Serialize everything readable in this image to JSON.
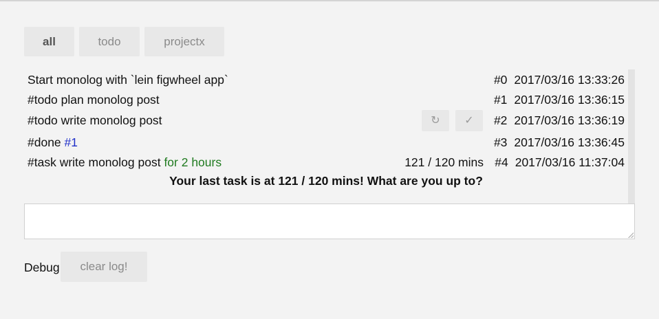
{
  "tabs": [
    {
      "label": "all",
      "active": true
    },
    {
      "label": "todo",
      "active": false
    },
    {
      "label": "projectx",
      "active": false
    }
  ],
  "log": {
    "rows": [
      {
        "text": "Start monolog with `lein figwheel app`",
        "index": "#0",
        "timestamp": "2017/03/16 13:33:26"
      },
      {
        "text": "#todo plan monolog post",
        "index": "#1",
        "timestamp": "2017/03/16 13:36:15"
      },
      {
        "text": "#todo write monolog post",
        "index": "#2",
        "timestamp": "2017/03/16 13:36:19",
        "actions": {
          "redo_icon": "↻",
          "check_icon": "✓"
        }
      },
      {
        "text_prefix": "#done ",
        "link": "#1",
        "index": "#3",
        "timestamp": "2017/03/16 13:36:45"
      },
      {
        "text_prefix": "#task write monolog post ",
        "duration": "for 2 hours",
        "mins": "121 / 120 mins",
        "index": "#4",
        "timestamp": "2017/03/16 11:37:04"
      }
    ],
    "warning": "Your last task is at 121 / 120 mins! What are you up to?"
  },
  "input": {
    "value": "",
    "placeholder": ""
  },
  "footer": {
    "debug_label": "Debug",
    "clear_label": "clear log!"
  },
  "colors": {
    "green": "#1f7a1f",
    "link_blue": "#1f2fc8",
    "button_bg": "#e8e8e8"
  }
}
